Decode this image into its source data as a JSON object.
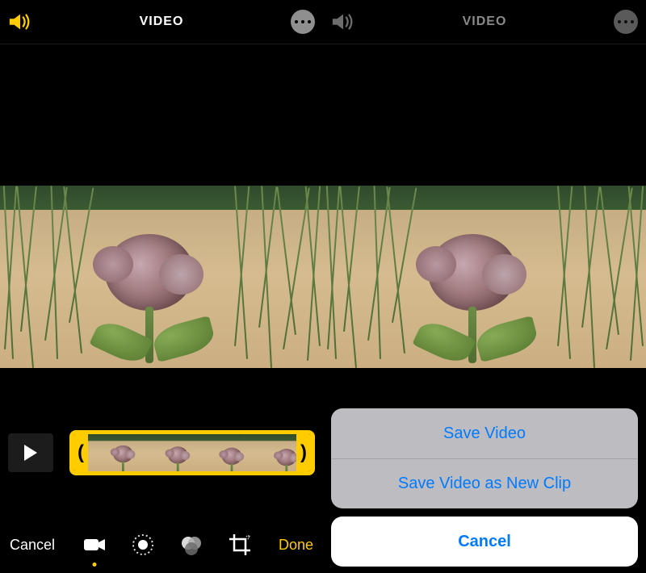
{
  "left": {
    "title": "VIDEO",
    "sound_on": true,
    "timeline": {
      "left_handle": "(",
      "right_handle": ")"
    },
    "cancel_label": "Cancel",
    "done_label": "Done",
    "tools": {
      "video": "video-icon",
      "adjust": "adjust-icon",
      "filters": "filters-icon",
      "crop": "crop-rotate-icon"
    }
  },
  "right": {
    "title": "VIDEO",
    "sound_on": true,
    "action_sheet": {
      "items": [
        "Save Video",
        "Save Video as New Clip"
      ],
      "cancel": "Cancel"
    }
  }
}
